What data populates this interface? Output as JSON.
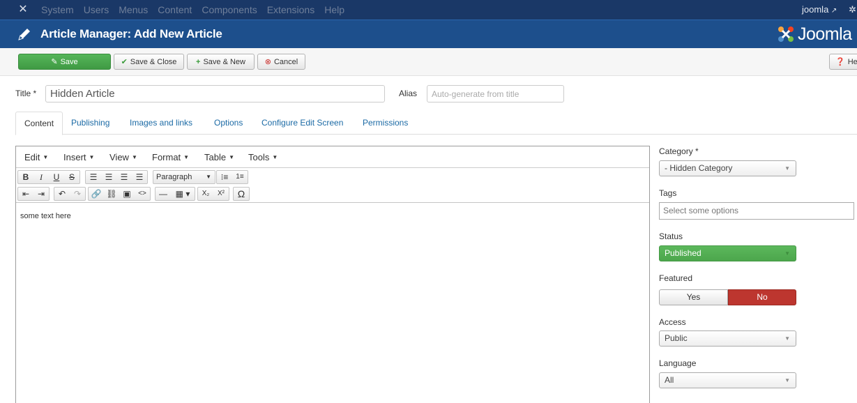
{
  "topnav": {
    "menu": [
      "System",
      "Users",
      "Menus",
      "Content",
      "Components",
      "Extensions",
      "Help"
    ],
    "user": "joomla",
    "logo_icon": "joomla-logo-icon",
    "gear_icon": "gear-icon"
  },
  "header": {
    "title": "Article Manager: Add New Article",
    "brand": "Joomla"
  },
  "toolbar": {
    "save": "Save",
    "save_close": "Save & Close",
    "save_new": "Save & New",
    "cancel": "Cancel",
    "help": "Help"
  },
  "form": {
    "title_label": "Title *",
    "title_value": "Hidden Article",
    "alias_label": "Alias",
    "alias_placeholder": "Auto-generate from title"
  },
  "tabs": [
    "Content",
    "Publishing",
    "Images and links",
    "Options",
    "Configure Edit Screen",
    "Permissions"
  ],
  "editor": {
    "menus": [
      "Edit",
      "Insert",
      "View",
      "Format",
      "Table",
      "Tools"
    ],
    "format_select": "Paragraph",
    "content": "some text here"
  },
  "sidebar": {
    "category_label": "Category *",
    "category_value": "- Hidden Category",
    "tags_label": "Tags",
    "tags_placeholder": "Select some options",
    "status_label": "Status",
    "status_value": "Published",
    "featured_label": "Featured",
    "featured_yes": "Yes",
    "featured_no": "No",
    "access_label": "Access",
    "access_value": "Public",
    "language_label": "Language",
    "language_value": "All"
  },
  "colors": {
    "nav_bg": "#1a3867",
    "header_bg": "#1d4f8c",
    "save_green": "#4cae4c",
    "featured_no_red": "#bd362f",
    "link_blue": "#1b6aa5"
  }
}
